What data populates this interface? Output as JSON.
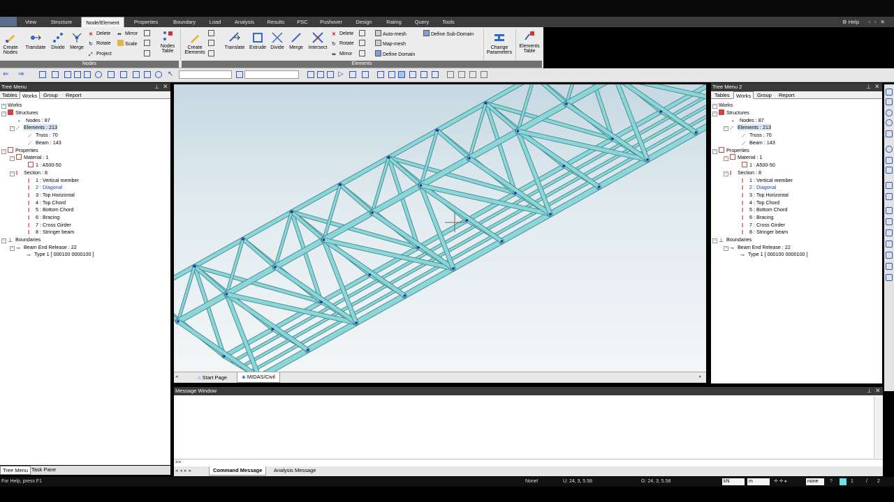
{
  "menu": {
    "items": [
      "View",
      "Structure",
      "Node/Element",
      "Properties",
      "Boundary",
      "Load",
      "Analysis",
      "Results",
      "PSC",
      "Pushover",
      "Design",
      "Rating",
      "Query",
      "Tools"
    ],
    "active": "Node/Element",
    "help": "Help"
  },
  "ribbon": {
    "nodes": {
      "create": "Create\nNodes",
      "translate": "Translate",
      "divide": "Divide",
      "merge": "Merge",
      "delete": "Delete",
      "rotate": "Rotate",
      "project": "Project",
      "mirror": "Mirror",
      "scale": "Scale",
      "table": "Nodes\nTable",
      "group_label": "Nodes"
    },
    "elements": {
      "create": "Create\nElements",
      "translate": "Translate",
      "extrude": "Extrude",
      "divide": "Divide",
      "merge": "Merge",
      "intersect": "Intersect",
      "delete": "Delete",
      "rotate": "Rotate",
      "mirror": "Mirror",
      "automesh": "Auto-mesh",
      "mapmesh": "Map-mesh",
      "define_domain": "Define Domain",
      "define_subdomain": "Define Sub-Domain",
      "change_params": "Change\nParameters",
      "table": "Elements\nTable",
      "group_label": "Elements"
    }
  },
  "left_panel": {
    "title": "Tree Menu",
    "tabs": [
      "Tables",
      "Works",
      "Group",
      "Report"
    ],
    "active_tab": "Works",
    "bottom_tabs": [
      "Tree Menu",
      "Task Pane"
    ]
  },
  "right_panel": {
    "title": "Tree Menu 2",
    "tabs": [
      "Tables",
      "Works",
      "Group",
      "Report"
    ],
    "active_tab": "Works"
  },
  "tree": {
    "works": "Works",
    "structures": "Structures",
    "nodes": "Nodes : 87",
    "elements": "Elements : 213",
    "truss": "Truss : 70",
    "beam": "Beam : 143",
    "properties": "Properties",
    "material": "Material : 1",
    "material_1": "1 : A500-50",
    "section": "Section : 8",
    "sections": [
      "1 : Vertical member",
      "2 : Diagonal",
      "3 : Top Horizontal",
      "4 : Top Chord",
      "5 : Bottom Chord",
      "6 : Bracing",
      "7 : Cross Girder",
      "8 : Stringer beam"
    ],
    "boundaries": "Boundaries",
    "release": "Beam End Release : 22",
    "type1": "Type 1 [ 000100 0000100 ]"
  },
  "viewport": {
    "tabs": [
      "Start Page",
      "MIDAS/Civil"
    ],
    "member_color": "#8ad6d8",
    "node_color": "#1a2fb0"
  },
  "message_window": {
    "title": "Message Window",
    "prompt": ">>",
    "tabs": [
      "Command Message",
      "Analysis Message"
    ]
  },
  "status": {
    "help": "For Help, press F1",
    "none": "None!",
    "u": "U: 24, 3, 5.58",
    "g": "G: 24, 3, 5.58",
    "force_unit": "kN",
    "length_unit": "m",
    "snap": "none",
    "page": "1",
    "pages": "2"
  }
}
